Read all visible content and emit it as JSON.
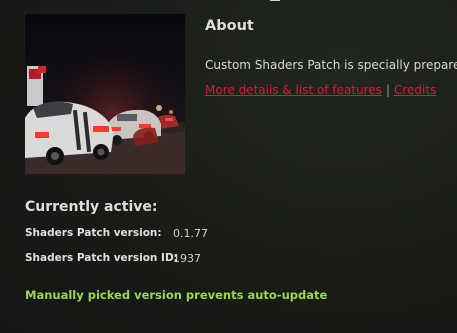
{
  "about": {
    "title": "About",
    "description": "Custom Shaders Patch is specially prepared",
    "link_details": "More details & list of features",
    "link_separator": "|",
    "link_credits": "Credits"
  },
  "current": {
    "title": "Currently active:",
    "rows": [
      {
        "label": "Shaders Patch version:",
        "value": "0.1.77"
      },
      {
        "label": "Shaders Patch version ID:",
        "value": "1937"
      }
    ],
    "notice": "Manually picked version prevents auto-update"
  },
  "colors": {
    "link": "#d21e3a",
    "notice": "#9ad84e"
  }
}
